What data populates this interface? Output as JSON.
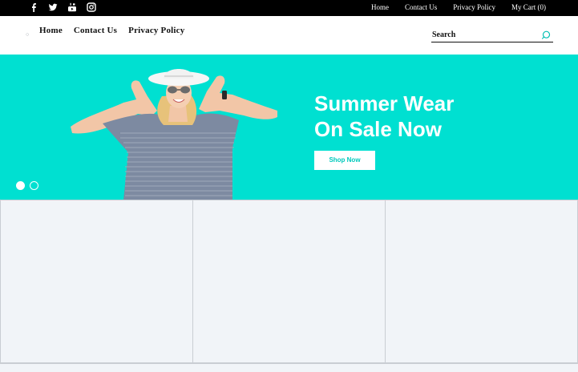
{
  "top_bar": {
    "social_icons": [
      "facebook-icon",
      "twitter-icon",
      "youtube-icon",
      "instagram-icon"
    ],
    "links": [
      "Home",
      "Contact Us",
      "Privacy Policy",
      "My Cart (0)"
    ]
  },
  "header": {
    "nav": [
      "Home",
      "Contact Us",
      "Privacy Policy"
    ],
    "search": {
      "placeholder": "Search",
      "icon": "search-icon"
    }
  },
  "hero": {
    "headline_line1": "Summer Wear",
    "headline_line2": "On Sale Now",
    "cta_label": "Shop Now",
    "slides": 2,
    "active_slide": 1
  },
  "colors": {
    "top_bar": "#000000",
    "hero_bg": "#00e0d1",
    "grid_bg": "#f1f4f8",
    "accent": "#00c9bc"
  }
}
